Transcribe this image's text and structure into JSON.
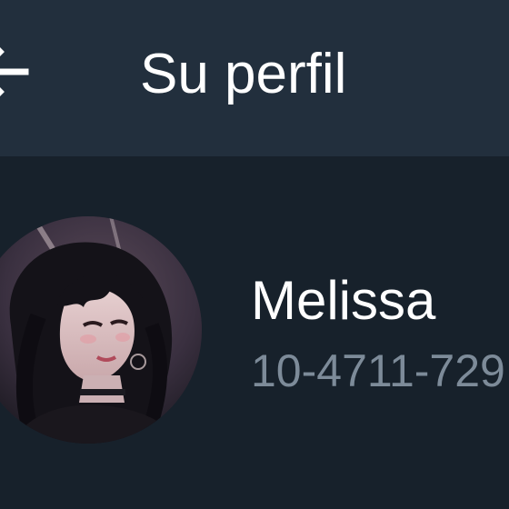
{
  "header": {
    "title": "Su perfil",
    "back_icon": "arrow-left-icon"
  },
  "profile": {
    "name": "Melissa",
    "phone": "10-4711-729"
  },
  "colors": {
    "app_bar": "#222f3d",
    "background": "#17212b",
    "text_primary": "#ffffff",
    "text_secondary": "#7d8b99"
  }
}
